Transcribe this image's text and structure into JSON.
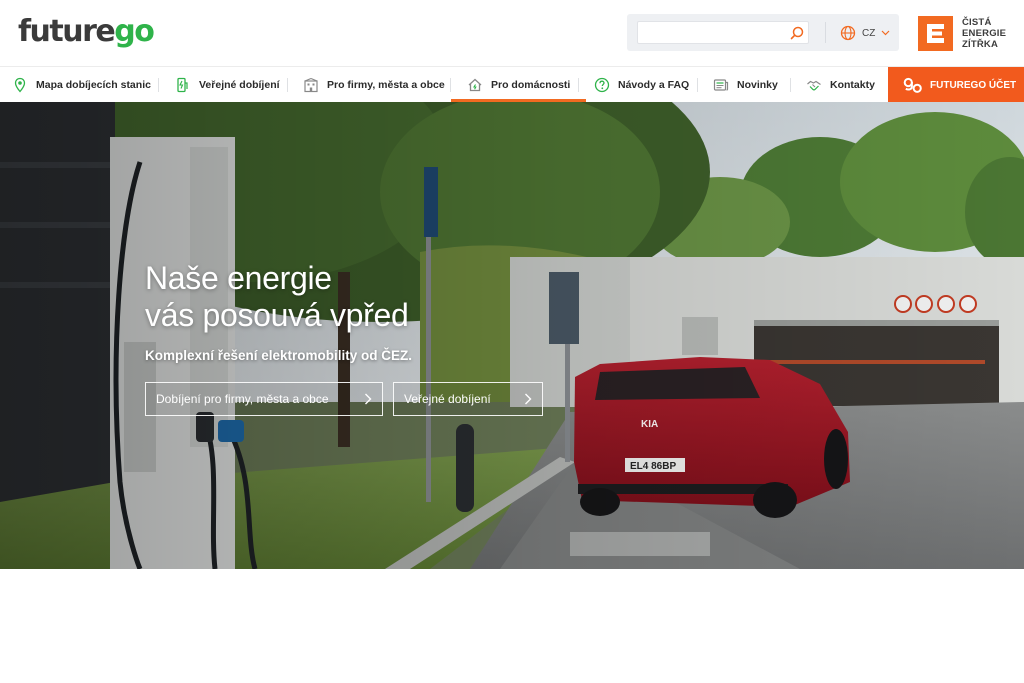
{
  "brand": {
    "logo_part1": "future",
    "logo_part2": "go"
  },
  "search": {
    "placeholder": "",
    "value": ""
  },
  "lang": {
    "code": "CZ"
  },
  "cez": {
    "line1": "ČISTÁ",
    "line2": "ENERGIE",
    "line3": "ZÍTŘKA"
  },
  "nav": {
    "items": [
      {
        "label": "Mapa dobíjecích stanic",
        "icon": "map-pin-icon"
      },
      {
        "label": "Veřejné dobíjení",
        "icon": "charger-icon"
      },
      {
        "label": "Pro firmy, města a obce",
        "icon": "building-icon"
      },
      {
        "label": "Pro domácnosti",
        "icon": "house-icon"
      },
      {
        "label": "Návody a FAQ",
        "icon": "question-icon"
      },
      {
        "label": "Novinky",
        "icon": "news-icon"
      },
      {
        "label": "Kontakty",
        "icon": "handshake-icon"
      }
    ],
    "active_index": 3,
    "account_label": "FUTUREGO ÚČET"
  },
  "hero": {
    "title_line1": "Naše energie",
    "title_line2": "vás posouvá vpřed",
    "subtitle": "Komplexní řešení elektromobility od ČEZ.",
    "btn1": "Dobíjení pro firmy, města a obce",
    "btn2": "Veřejné dobíjení",
    "plate": "EL4 86BP",
    "car_brand": "KIA"
  },
  "colors": {
    "accent": "#f26a21",
    "brand_green": "#2fb34a",
    "text_dark": "#2b2b2b"
  }
}
